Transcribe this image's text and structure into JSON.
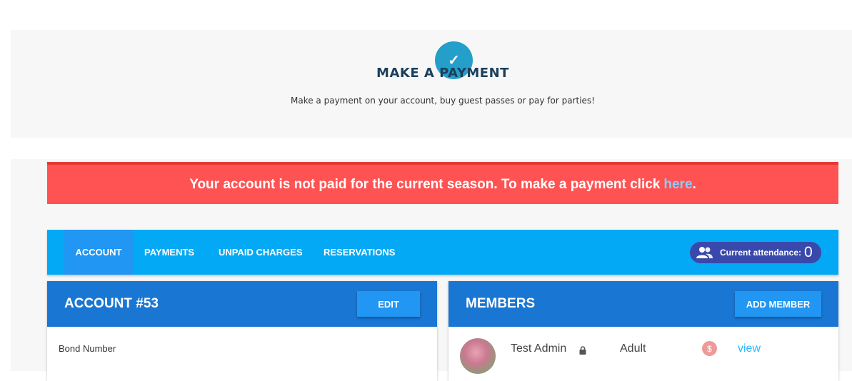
{
  "hero": {
    "title": "MAKE A PAYMENT",
    "subtitle": "Make a payment on your account, buy guest passes or pay for parties!",
    "icon": "check-icon"
  },
  "alert": {
    "message": "Your account is not paid for the current season. To make a payment click",
    "link_text": "here",
    "suffix": "."
  },
  "nav": {
    "tabs": [
      {
        "label": "ACCOUNT",
        "active": true
      },
      {
        "label": "PAYMENTS",
        "active": false
      },
      {
        "label": "UNPAID CHARGES",
        "active": false
      },
      {
        "label": "RESERVATIONS",
        "active": false
      }
    ],
    "attendance_label": "Current attendance:",
    "attendance_count": "0"
  },
  "account_card": {
    "title": "ACCOUNT #53",
    "edit_label": "EDIT",
    "field_label": "Bond Number"
  },
  "members_card": {
    "title": "MEMBERS",
    "add_label": "ADD MEMBER",
    "members": [
      {
        "name": "Test Admin",
        "type": "Adult",
        "view_label": "view",
        "dollar_symbol": "$"
      }
    ]
  },
  "colors": {
    "accent": "#03a9f4",
    "card_header": "#1976d2",
    "button": "#2196f3",
    "alert": "#ff5252",
    "check": "#239fca"
  }
}
